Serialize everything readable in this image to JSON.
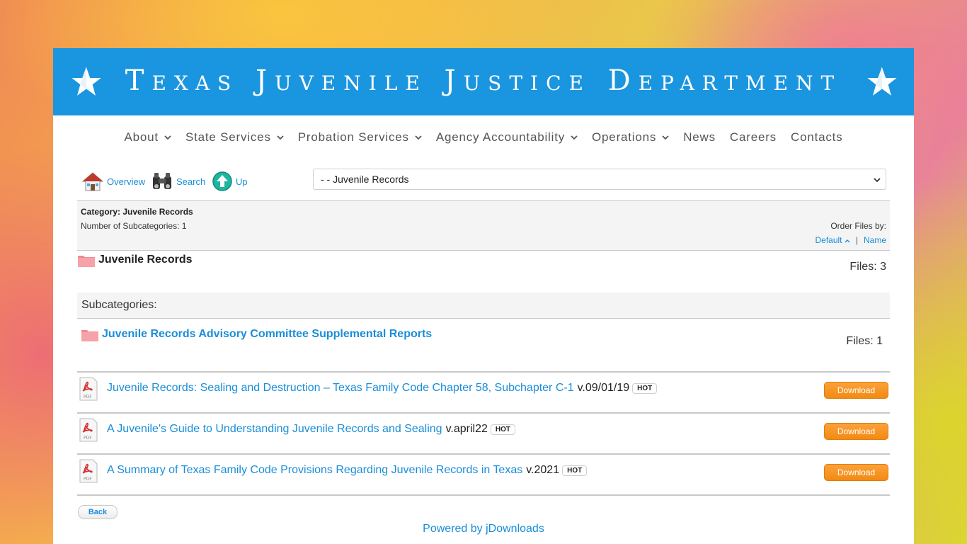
{
  "banner": {
    "title": "Texas Juvenile Justice Department"
  },
  "nav": {
    "items": [
      {
        "label": "About",
        "dropdown": true
      },
      {
        "label": "State Services",
        "dropdown": true
      },
      {
        "label": "Probation Services",
        "dropdown": true
      },
      {
        "label": "Agency Accountability",
        "dropdown": true
      },
      {
        "label": "Operations",
        "dropdown": true
      },
      {
        "label": "News",
        "dropdown": false
      },
      {
        "label": "Careers",
        "dropdown": false
      },
      {
        "label": "Contacts",
        "dropdown": false
      }
    ]
  },
  "toolbar": {
    "overview_label": "Overview",
    "search_label": "Search",
    "up_label": "Up",
    "category_select_value": "- - Juvenile Records"
  },
  "info": {
    "category_line": "Category: Juvenile Records",
    "subcategories_line": "Number of Subcategories: 1",
    "order_label": "Order Files by:",
    "order_default": "Default",
    "order_sep": "|",
    "order_name": "Name"
  },
  "category": {
    "name": "Juvenile Records",
    "files": "Files: 3"
  },
  "subcategories": {
    "heading": "Subcategories:",
    "items": [
      {
        "name": "Juvenile Records Advisory Committee Supplemental Reports",
        "files": "Files: 1"
      }
    ]
  },
  "files": [
    {
      "title": "Juvenile Records: Sealing and Destruction – Texas Family Code Chapter 58, Subchapter C-1",
      "version": "v.09/01/19",
      "badge": "HOT",
      "button": "Download"
    },
    {
      "title": "A Juvenile's Guide to Understanding Juvenile Records and Sealing",
      "version": "v.april22",
      "badge": "HOT",
      "button": "Download"
    },
    {
      "title": "A Summary of Texas Family Code Provisions Regarding Juvenile Records in Texas",
      "version": "v.2021",
      "badge": "HOT",
      "button": "Download"
    }
  ],
  "footer": {
    "back_label": "Back",
    "powered_by": "Powered by jDownloads"
  },
  "colors": {
    "banner_blue": "#1a95e0",
    "link_blue": "#1a8ed8",
    "download_orange": "#f28a12"
  }
}
